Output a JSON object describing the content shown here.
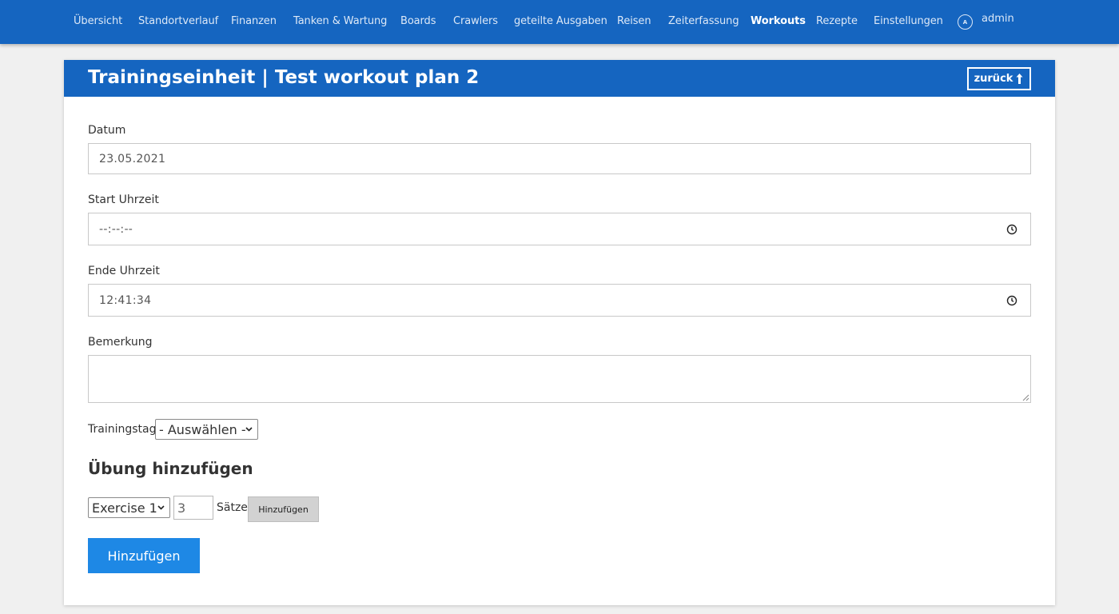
{
  "nav": {
    "items": [
      {
        "label": "Übersicht",
        "active": false
      },
      {
        "label": "Standortverlauf",
        "active": false
      },
      {
        "label": "Finanzen",
        "active": false
      },
      {
        "label": "Tanken & Wartung",
        "active": false
      },
      {
        "label": "Boards",
        "active": false
      },
      {
        "label": "Crawlers",
        "active": false
      },
      {
        "label": "geteilte Ausgaben",
        "active": false
      },
      {
        "label": "Reisen",
        "active": false
      },
      {
        "label": "Zeiterfassung",
        "active": false
      },
      {
        "label": "Workouts",
        "active": true
      },
      {
        "label": "Rezepte",
        "active": false
      },
      {
        "label": "Einstellungen",
        "active": false
      }
    ],
    "user": {
      "avatar_letter": "A",
      "name": "admin"
    }
  },
  "page": {
    "title": "Trainingseinheit | Test workout plan 2",
    "back_label": "zurück",
    "back_icon": "arrow-up-icon"
  },
  "form": {
    "date": {
      "label": "Datum",
      "value": "23.05.2021"
    },
    "start_time": {
      "label": "Start Uhrzeit",
      "value": "--:--:--",
      "icon": "clock-icon"
    },
    "end_time": {
      "label": "Ende Uhrzeit",
      "value": "12:41:34",
      "icon": "clock-icon"
    },
    "note": {
      "label": "Bemerkung",
      "value": ""
    },
    "training_day": {
      "label": "Trainingstag",
      "selected": "- Auswählen -"
    }
  },
  "add_exercise": {
    "heading": "Übung hinzufügen",
    "exercise_selected": "Exercise 1",
    "sets_value": "3",
    "sets_label": "Sätze",
    "add_button_label": "Hinzufügen"
  },
  "submit": {
    "label": "Hinzufügen"
  },
  "colors": {
    "nav_bg": "#1565c0",
    "header_bg": "#1565c0",
    "primary_button": "#1e88e5",
    "page_bg": "#f0f0f0"
  }
}
